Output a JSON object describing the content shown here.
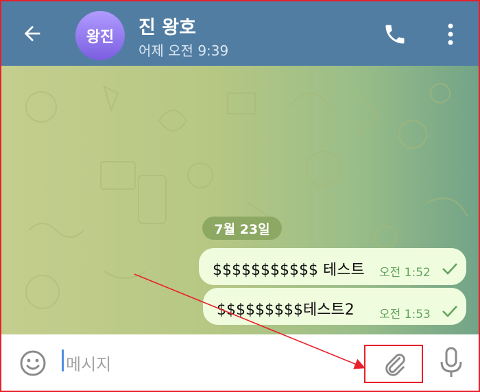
{
  "header": {
    "avatar_text": "왕진",
    "title": "진 왕호",
    "subtitle": "어제 오전 9:39",
    "color": "#517da2"
  },
  "chat": {
    "date_label": "7월 23일",
    "messages": [
      {
        "text": "$$$$$$$$$$$ 테스트",
        "time": "오전 1:52",
        "status": "check-icon"
      },
      {
        "text": "$$$$$$$$$테스트2",
        "time": "오전 1:53",
        "status": "check-icon"
      }
    ]
  },
  "input": {
    "placeholder": "메시지"
  },
  "icons": [
    "back-arrow-icon",
    "phone-icon",
    "more-vert-icon",
    "emoji-icon",
    "attach-icon",
    "mic-icon"
  ],
  "annotation": {
    "highlight_color": "#e8202a"
  }
}
